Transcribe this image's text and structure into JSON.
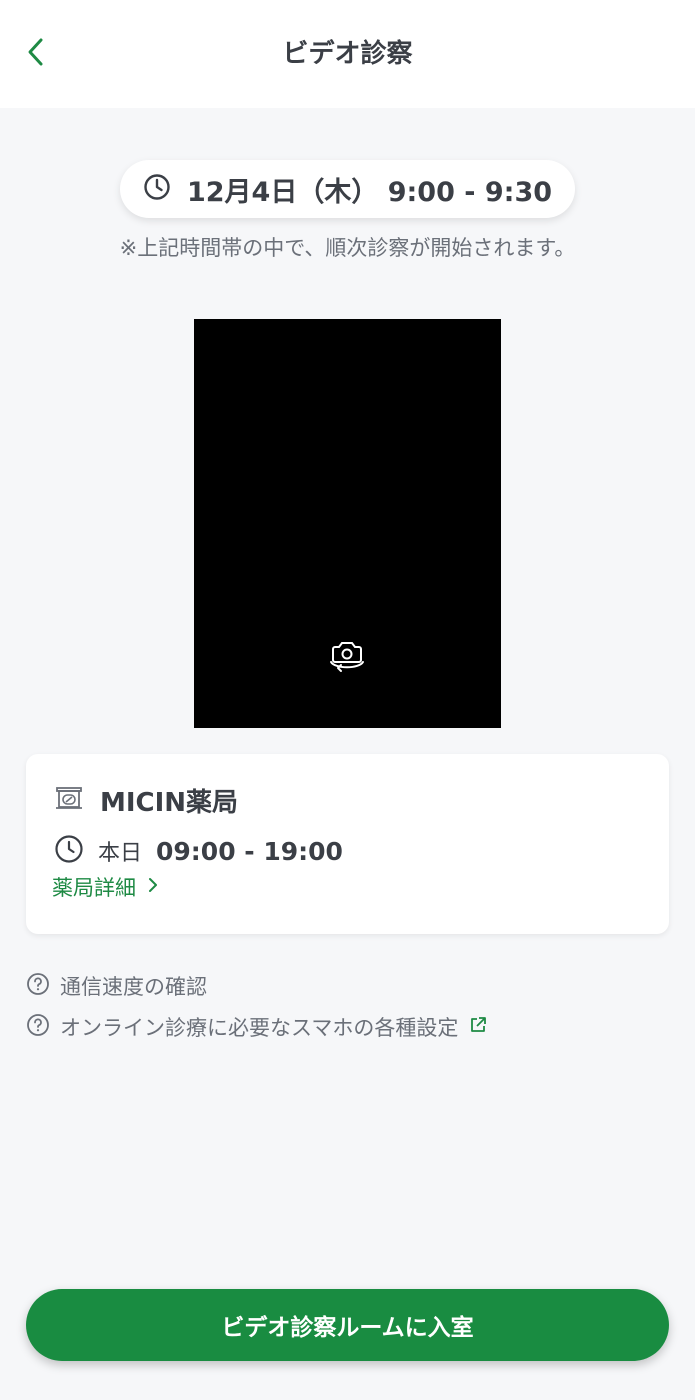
{
  "header": {
    "title": "ビデオ診察",
    "back_icon": "chevron-left-icon"
  },
  "appointment": {
    "time_text": "12月4日（木） 9:00 - 9:30",
    "note": "※上記時間帯の中で、順次診察が開始されます。"
  },
  "video": {
    "switch_camera_icon": "switch-camera-icon"
  },
  "pharmacy": {
    "name": "MICIN薬局",
    "hours_label": "本日",
    "hours_value": "09:00 - 19:00",
    "detail_link": "薬局詳細"
  },
  "help_links": {
    "speed_check": "通信速度の確認",
    "settings": "オンライン診療に必要なスマホの各種設定"
  },
  "footer": {
    "enter_button": "ビデオ診察ルームに入室"
  },
  "colors": {
    "accent_green": "#198c41",
    "link_green": "#1e8a44",
    "background": "#f6f7f9",
    "text_dark": "#3b3f46",
    "text_muted": "#6b7079"
  }
}
